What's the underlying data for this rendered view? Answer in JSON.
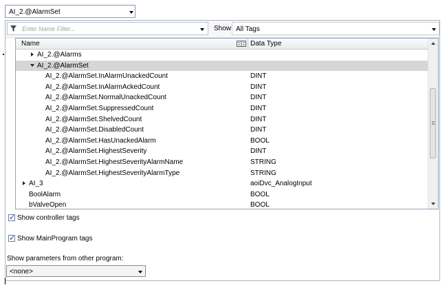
{
  "scope_combo": {
    "value": "AI_2.@AlarmSet"
  },
  "filter": {
    "placeholder": "Enter Name Filter...",
    "show_label": "Show:",
    "show_value": "All Tags"
  },
  "columns": {
    "name": "Name",
    "data_type": "Data Type"
  },
  "rows": [
    {
      "name": "AI_2.@Alarms",
      "type": "",
      "level": 1,
      "expander": "collapsed"
    },
    {
      "name": "AI_2.@AlarmSet",
      "type": "",
      "level": 1,
      "expander": "expanded",
      "selected": true
    },
    {
      "name": "AI_2.@AlarmSet.InAlarmUnackedCount",
      "type": "DINT",
      "level": 2
    },
    {
      "name": "AI_2.@AlarmSet.InAlarmAckedCount",
      "type": "DINT",
      "level": 2
    },
    {
      "name": "AI_2.@AlarmSet.NormalUnackedCount",
      "type": "DINT",
      "level": 2
    },
    {
      "name": "AI_2.@AlarmSet.SuppressedCount",
      "type": "DINT",
      "level": 2
    },
    {
      "name": "AI_2.@AlarmSet.ShelvedCount",
      "type": "DINT",
      "level": 2
    },
    {
      "name": "AI_2.@AlarmSet.DisabledCount",
      "type": "DINT",
      "level": 2
    },
    {
      "name": "AI_2.@AlarmSet.HasUnackedAlarm",
      "type": "BOOL",
      "level": 2
    },
    {
      "name": "AI_2.@AlarmSet.HighestSeverity",
      "type": "DINT",
      "level": 2
    },
    {
      "name": "AI_2.@AlarmSet.HighestSeverityAlarmName",
      "type": "STRING",
      "level": 2
    },
    {
      "name": "AI_2.@AlarmSet.HighestSeverityAlarmType",
      "type": "STRING",
      "level": 2
    },
    {
      "name": "AI_3",
      "type": "aoiDvc_AnalogInput",
      "level": 0,
      "expander": "collapsed"
    },
    {
      "name": "BoolAlarm",
      "type": "BOOL",
      "level": 0,
      "icon": "tag"
    },
    {
      "name": "bValveOpen",
      "type": "BOOL",
      "level": 0,
      "icon": "tag"
    }
  ],
  "options": {
    "show_controller_tags": "Show controller tags",
    "show_mainprogram_tags": "Show MainProgram tags",
    "params_label": "Show parameters from other program:",
    "params_value": "<none>"
  }
}
